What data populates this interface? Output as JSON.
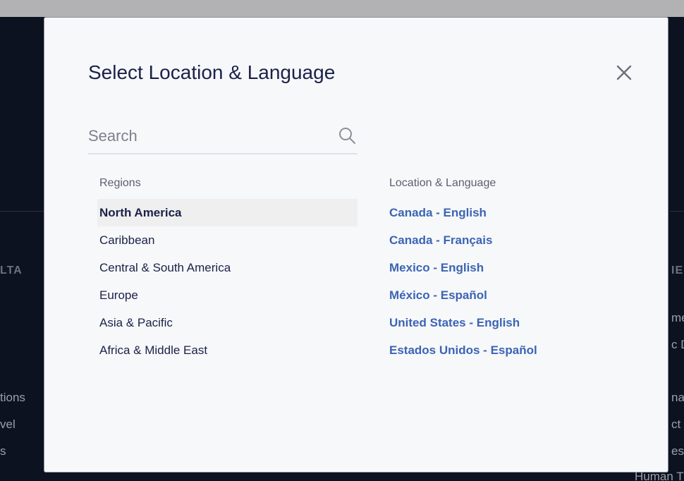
{
  "background": {
    "left_heading": "LTA",
    "left_items": [
      "tions",
      "vel",
      "s"
    ],
    "right_heading": "IE",
    "right_items": [
      "me",
      "c D",
      "nal",
      "ct",
      "es,",
      "Human T"
    ]
  },
  "modal": {
    "title": "Select Location & Language",
    "close_icon": "close-icon"
  },
  "search": {
    "placeholder": "Search",
    "value": "",
    "icon": "search-icon"
  },
  "regions": {
    "label": "Regions",
    "selected": "North America",
    "items": [
      "North America",
      "Caribbean",
      "Central & South America",
      "Europe",
      "Asia & Pacific",
      "Africa & Middle East"
    ]
  },
  "locations": {
    "label": "Location & Language",
    "items": [
      "Canada - English",
      "Canada - Français",
      "Mexico - English",
      "México - Español",
      "United States - English",
      "Estados Unidos - Español"
    ]
  },
  "colors": {
    "title": "#1b2148",
    "link": "#3b64b4",
    "selected_bg": "#efeff0",
    "overlay": "#0d1220",
    "modal_bg": "#f7f8fa"
  }
}
